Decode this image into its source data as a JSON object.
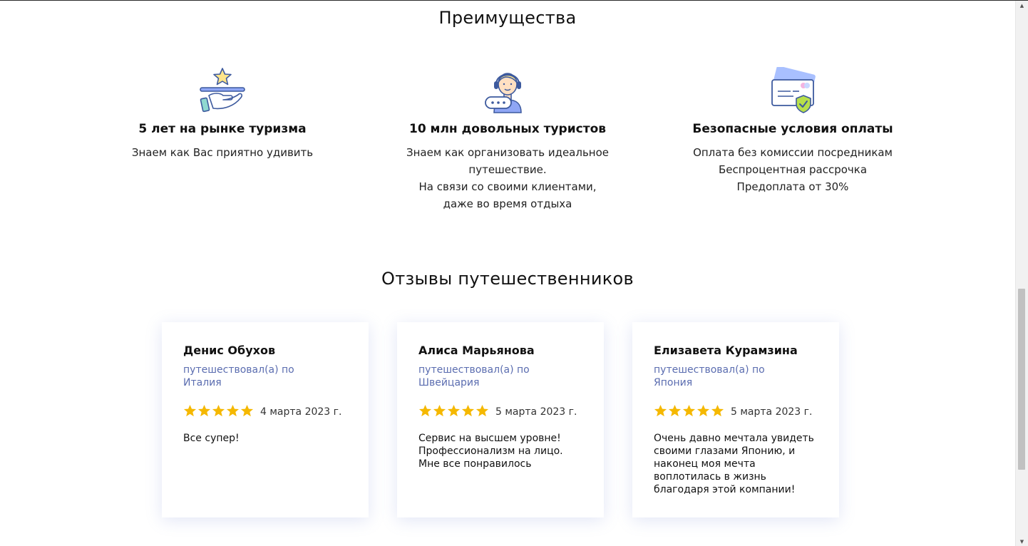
{
  "advantages": {
    "title": "Преимущества",
    "items": [
      {
        "icon": "service-star-icon",
        "heading": "5 лет на рынке туризма",
        "lines": [
          "Знаем как Вас приятно удивить"
        ]
      },
      {
        "icon": "support-operator-icon",
        "heading": "10 млн довольных туристов",
        "lines": [
          "Знаем как организовать идеальное",
          "путешествие.",
          "На связи со своими клиентами,",
          "даже во время отдыха"
        ]
      },
      {
        "icon": "secure-card-icon",
        "heading": "Безопасные условия оплаты",
        "lines": [
          "Оплата без комиссии посредникам",
          "Беспроцентная рассрочка",
          "Предоплата от 30%"
        ]
      }
    ]
  },
  "reviews": {
    "title": "Отзывы путешественников",
    "items": [
      {
        "name": "Денис Обухов",
        "trip_lines": [
          "путешествовал(а) по",
          "Италия"
        ],
        "rating": 5,
        "date": "4 марта 2023 г.",
        "text_lines": [
          "Все супер!"
        ]
      },
      {
        "name": "Алиса Марьянова",
        "trip_lines": [
          "путешествовал(а) по",
          "Швейцария"
        ],
        "rating": 5,
        "date": "5 марта 2023 г.",
        "text_lines": [
          "Сервис на высшем уровне!",
          "Профессионализм на лицо.",
          "Мне все понравилось"
        ]
      },
      {
        "name": "Елизавета Курамзина",
        "trip_lines": [
          "путешествовал(а) по",
          "Япония"
        ],
        "rating": 5,
        "date": "5 марта 2023 г.",
        "text_lines": [
          "Очень давно мечтала увидеть",
          "своими глазами Японию, и",
          "наконец моя мечта",
          "воплотилась в жизнь",
          "благодаря этой компании!"
        ]
      }
    ]
  },
  "colors": {
    "star": "#f5b800",
    "trip_text": "#5b6db0",
    "icon_blue": "#3d5a9e",
    "icon_accent": "#8fa6f5",
    "icon_check": "#b8e04a"
  }
}
